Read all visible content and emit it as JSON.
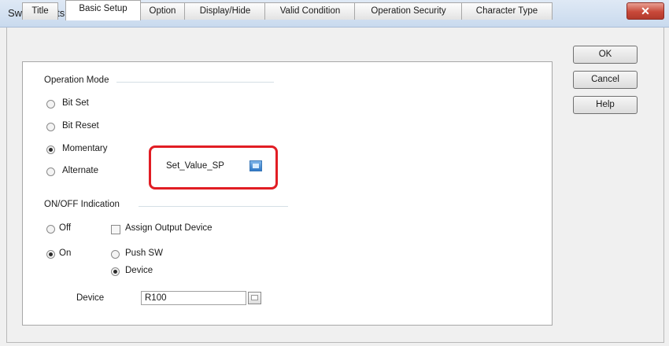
{
  "window": {
    "title": "Switch Parts No.0",
    "close_glyph": "✕"
  },
  "tabs": [
    {
      "label": "Title"
    },
    {
      "label": "Basic Setup",
      "active": true
    },
    {
      "label": "Option"
    },
    {
      "label": "Display/Hide"
    },
    {
      "label": "Valid Condition"
    },
    {
      "label": "Operation Security"
    },
    {
      "label": "Character Type"
    }
  ],
  "buttons": {
    "ok": "OK",
    "cancel": "Cancel",
    "help": "Help"
  },
  "operation_mode": {
    "heading": "Operation Mode",
    "options": [
      {
        "label": "Bit Set",
        "selected": false
      },
      {
        "label": "Bit Reset",
        "selected": false
      },
      {
        "label": "Momentary",
        "selected": true
      },
      {
        "label": "Alternate",
        "selected": false
      }
    ],
    "device_value": "Set_Value_SP"
  },
  "onoff": {
    "heading": "ON/OFF Indication",
    "off": {
      "label": "Off",
      "selected": false
    },
    "on": {
      "label": "On",
      "selected": true
    },
    "assign_output_device": {
      "label": "Assign Output Device",
      "checked": false
    },
    "push_sw": {
      "label": "Push SW",
      "selected": false
    },
    "device_option": {
      "label": "Device",
      "selected": true
    },
    "device_field": {
      "label": "Device",
      "value": "R100"
    }
  },
  "colors": {
    "highlight": "#e11d24",
    "title_bar": "#c9daee",
    "close_button": "#c8493a"
  },
  "icons": {
    "device_browse_active": "browse-blue-icon",
    "device_browse": "browse-icon"
  }
}
